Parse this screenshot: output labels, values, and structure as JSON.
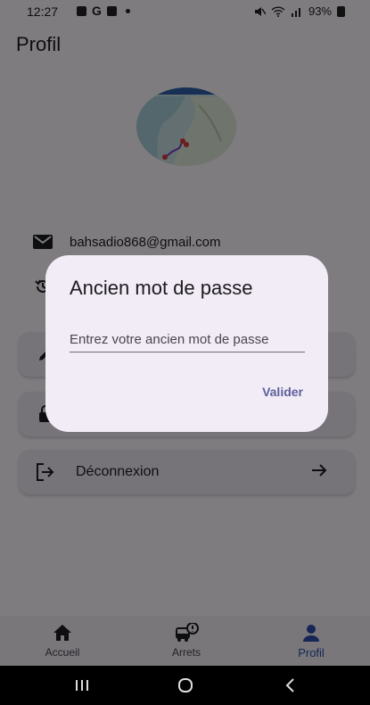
{
  "status_bar": {
    "time": "12:27",
    "battery": "93%"
  },
  "page_title": "Profil",
  "profile": {
    "email": "bahsadio868@gmail.com"
  },
  "menu": [
    {
      "label": "",
      "icon": "edit-icon"
    },
    {
      "label": "",
      "icon": "lock-icon"
    },
    {
      "label": "Déconnexion",
      "icon": "logout-icon",
      "trailing_icon": "arrow-right-icon"
    }
  ],
  "dialog": {
    "title": "Ancien mot de passe",
    "input_placeholder": "Entrez votre ancien mot de passe",
    "input_value": "",
    "confirm_label": "Valider"
  },
  "bottom_nav": {
    "items": [
      {
        "label": "Accueil",
        "icon": "home-icon",
        "active": false
      },
      {
        "label": "Arrets",
        "icon": "bus-alert-icon",
        "active": false
      },
      {
        "label": "Profil",
        "icon": "person-icon",
        "active": true
      }
    ]
  },
  "colors": {
    "accent": "#2d4cab",
    "dialog_bg": "#f2ecf6",
    "scrim": "#000000"
  }
}
